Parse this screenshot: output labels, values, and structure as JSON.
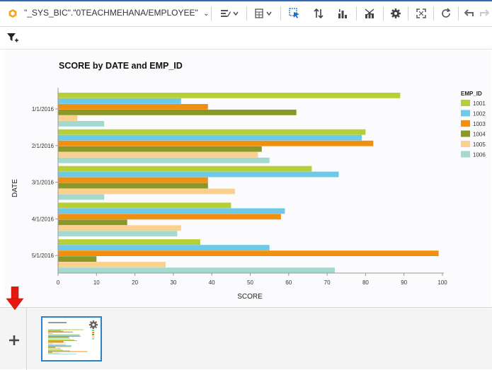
{
  "toolbar": {
    "datasource": "\"_SYS_BIC\".\"0TEACHMEHANA/EMPLOYEE\"",
    "icons": [
      "datasource-cube-icon",
      "chevron-down-icon",
      "chart-type-icon",
      "table-view-icon",
      "select-icon",
      "sort-icon",
      "bar-chart-icon",
      "clear-chart-icon",
      "gear-icon",
      "fullscreen-icon",
      "refresh-icon",
      "undo-icon",
      "redo-icon"
    ]
  },
  "colors": {
    "accent": "#2d7fc6",
    "toolbar_line": "#2d6db5",
    "arrow": "#e3180f"
  },
  "chart_data": {
    "type": "bar",
    "orientation": "horizontal",
    "title": "SCORE by DATE and EMP_ID",
    "xlabel": "SCORE",
    "ylabel": "DATE",
    "xlim": [
      0,
      100
    ],
    "xticks": [
      "0",
      "10",
      "20",
      "30",
      "40",
      "50",
      "60",
      "70",
      "80",
      "90",
      "100"
    ],
    "categories": [
      "1/1/2016",
      "2/1/2016",
      "3/1/2016",
      "4/1/2016",
      "5/1/2016"
    ],
    "legend_title": "EMP_ID",
    "legend_position": "right",
    "grid": false,
    "series": [
      {
        "name": "1001",
        "color": "#b5cf34",
        "values": [
          89,
          80,
          66,
          45,
          37
        ]
      },
      {
        "name": "1002",
        "color": "#6cc9e8",
        "values": [
          32,
          79,
          73,
          59,
          55
        ]
      },
      {
        "name": "1003",
        "color": "#f0900e",
        "values": [
          39,
          82,
          39,
          58,
          99
        ]
      },
      {
        "name": "1004",
        "color": "#8c9826",
        "values": [
          62,
          53,
          39,
          18,
          10
        ]
      },
      {
        "name": "1005",
        "color": "#fbd08c",
        "values": [
          5,
          52,
          46,
          32,
          28
        ]
      },
      {
        "name": "1006",
        "color": "#a3d9cf",
        "values": [
          12,
          55,
          12,
          31,
          72
        ]
      }
    ]
  }
}
